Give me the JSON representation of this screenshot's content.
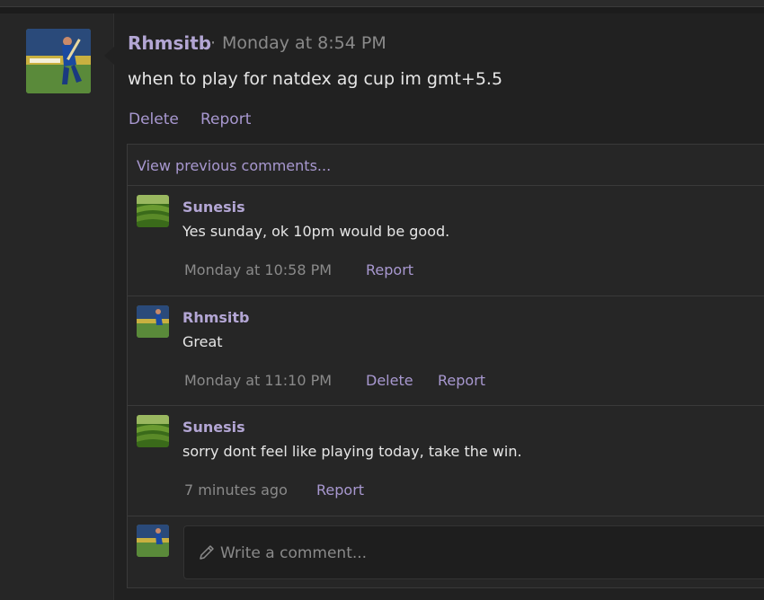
{
  "post": {
    "author": "Rhmsitb",
    "separator": "·",
    "time": "Monday at 8:54 PM",
    "text": "when to play for natdex ag cup im gmt+5.5",
    "actions": {
      "delete": "Delete",
      "report": "Report"
    }
  },
  "comments_section": {
    "view_previous": "View previous comments...",
    "comments": [
      {
        "author": "Sunesis",
        "text": "Yes sunday, ok 10pm would be good.",
        "time": "Monday at 10:58 PM",
        "report": "Report"
      },
      {
        "author": "Rhmsitb",
        "text": "Great",
        "time": "Monday at 11:10 PM",
        "delete": "Delete",
        "report": "Report"
      },
      {
        "author": "Sunesis",
        "text": "sorry dont feel like playing today, take the win.",
        "time": "7 minutes ago",
        "report": "Report"
      }
    ],
    "reply_placeholder": "Write a comment..."
  },
  "icons": {
    "reply": "pencil-icon"
  },
  "colors": {
    "accent": "#a898d0",
    "author": "#b3a6d4",
    "muted": "#8a8a8a",
    "text": "#e6e6e6"
  }
}
